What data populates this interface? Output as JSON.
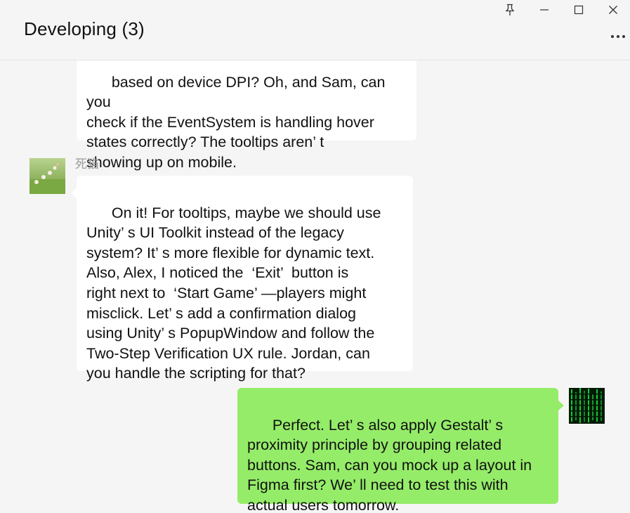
{
  "window": {
    "title": "Developing (3)"
  },
  "controls": {
    "pin_icon": "pin-icon",
    "minimize_icon": "minimize-icon",
    "maximize_icon": "maximize-icon",
    "close_icon": "close-icon",
    "more_icon": "more-icon"
  },
  "messages": [
    {
      "sender": "",
      "self": false,
      "text": "based on device DPI? Oh, and Sam, can you\ncheck if the EventSystem is handling hover\nstates correctly? The tooltips aren’ t\nshowing up on mobile."
    },
    {
      "sender": "死猫",
      "self": false,
      "text": "On it! For tooltips, maybe we should use\nUnity’ s UI Toolkit instead of the legacy\nsystem? It’ s more flexible for dynamic text.\nAlso, Alex, I noticed the  ‘Exit’  button is\nright next to  ‘Start Game’ —players might\nmisclick. Let’ s add a confirmation dialog\nusing Unity’ s PopupWindow and follow the\nTwo-Step Verification UX rule. Jordan, can\nyou handle the scripting for that?"
    },
    {
      "sender": "",
      "self": true,
      "text": "Perfect. Let’ s also apply Gestalt’ s\nproximity principle by grouping related\nbuttons. Sam, can you mock up a layout in\nFigma first? We’ ll need to test this with\nactual users tomorrow."
    }
  ],
  "colors": {
    "background": "#f5f5f5",
    "incoming_bubble": "#ffffff",
    "outgoing_bubble": "#95ec69",
    "sender_name": "#9a9a9a"
  }
}
